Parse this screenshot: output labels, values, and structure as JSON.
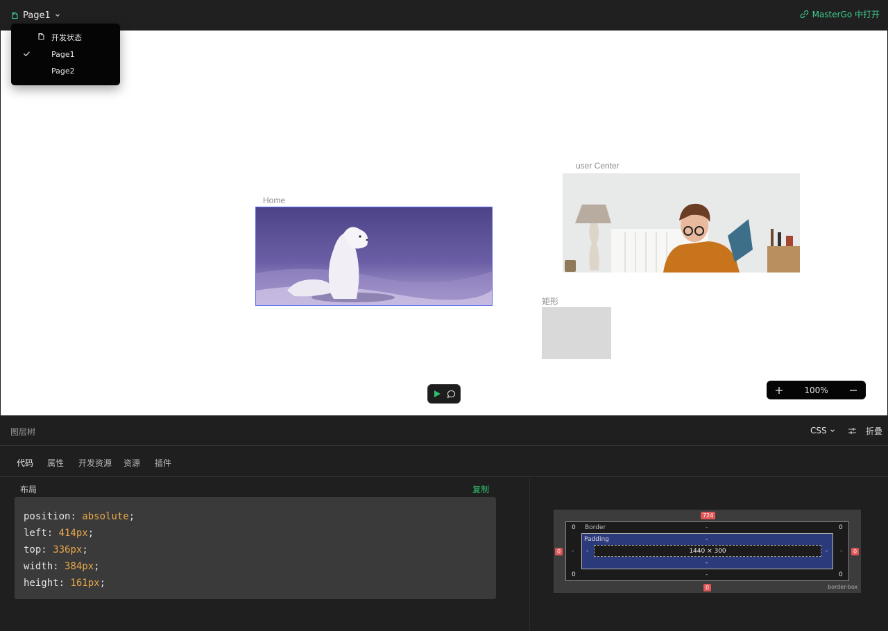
{
  "topbar": {
    "page_name": "Page1",
    "open_link": "MasterGo 中打开",
    "accent_color": "#3ecf8e"
  },
  "dropdown": {
    "items": [
      {
        "label": "开发状态",
        "icon": "dev-status-icon"
      },
      {
        "label": "Page1",
        "checked": true
      },
      {
        "label": "Page2"
      }
    ]
  },
  "canvas": {
    "frames": [
      {
        "label": "Home"
      },
      {
        "label": "user Center"
      },
      {
        "label": "矩形"
      }
    ],
    "zoom": "100%"
  },
  "panel": {
    "title": "图层树",
    "lang": "CSS",
    "collapse": "折叠",
    "tabs": [
      "代码",
      "属性",
      "开发资源",
      "资源",
      "插件"
    ],
    "active_tab": "代码",
    "section_title": "布局",
    "copy": "复制",
    "code": [
      {
        "prop": "position",
        "value": "absolute"
      },
      {
        "prop": "left",
        "value": "414px"
      },
      {
        "prop": "top",
        "value": "336px"
      },
      {
        "prop": "width",
        "value": "384px"
      },
      {
        "prop": "height",
        "value": "161px"
      }
    ]
  },
  "box_model": {
    "margin_top": "724",
    "margin_bottom": "0",
    "margin_left": "0",
    "margin_right": "0",
    "border_label": "Border",
    "padding_label": "Padding",
    "size": "1440 × 300",
    "border_corners": "0",
    "dash": "-",
    "box_sizing": "border-box"
  }
}
